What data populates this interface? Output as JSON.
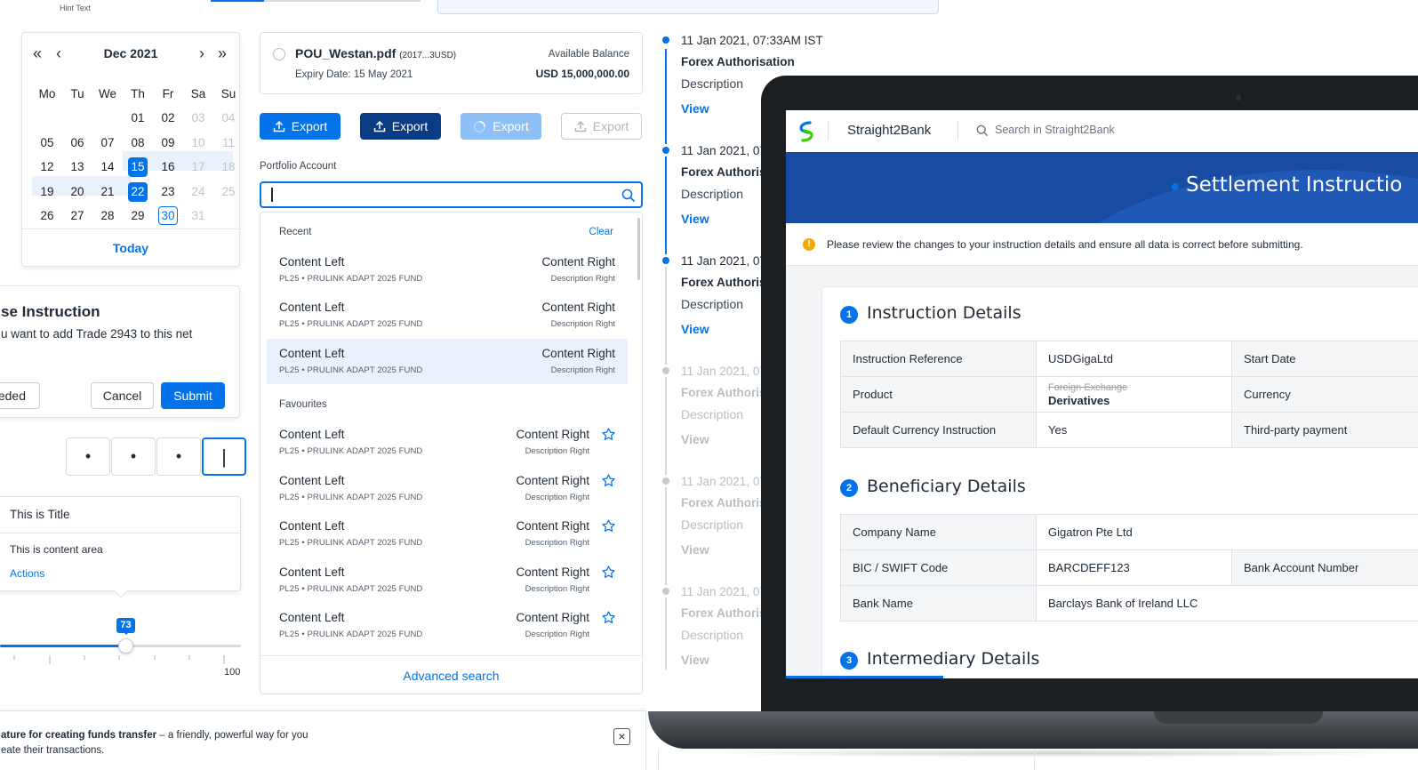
{
  "top": {
    "hint_text": "Hint Text"
  },
  "calendar": {
    "month_label": "Dec 2021",
    "nav": {
      "first": "«",
      "prev": "‹",
      "next": "›",
      "last": "»"
    },
    "weekdays": [
      "Mo",
      "Tu",
      "We",
      "Th",
      "Fr",
      "Sa",
      "Su"
    ],
    "rows": [
      [
        "",
        "",
        "",
        "01",
        "02",
        "03",
        "04"
      ],
      [
        "05",
        "06",
        "07",
        "08",
        "09",
        "10",
        "11"
      ],
      [
        "12",
        "13",
        "14",
        "15",
        "16",
        "17",
        "18"
      ],
      [
        "19",
        "20",
        "21",
        "22",
        "23",
        "24",
        "25"
      ],
      [
        "26",
        "27",
        "28",
        "29",
        "30",
        "31",
        ""
      ]
    ],
    "today_label": "Today"
  },
  "dialog": {
    "title": "se Instruction",
    "body": "u want to add Trade 2943 to this net",
    "left_button": "eded",
    "cancel": "Cancel",
    "submit": "Submit"
  },
  "pin": {
    "digits": [
      "•",
      "•",
      "•",
      "|"
    ]
  },
  "popover": {
    "title": "This is Title",
    "content": "This is content area",
    "actions": "Actions"
  },
  "slider": {
    "value": "73",
    "max_label": "100",
    "value_fraction": 0.73
  },
  "banner": {
    "bold": "ature for creating funds transfer",
    "rest": " – a friendly, powerful way for you",
    "line2": "eate their transactions.",
    "close": "×"
  },
  "file_card": {
    "name": "POU_Westan.pdf",
    "meta": "(2017...3USD)",
    "expiry": "Expiry Date: 15 May 2021",
    "balance_label": "Available Balance",
    "balance_value": "USD 15,000,000.00"
  },
  "buttons": {
    "export": "Export"
  },
  "portfolio": {
    "label": "Portfolio Account",
    "input_value": "",
    "recent_header": "Recent",
    "clear": "Clear",
    "favourites_header": "Favourites",
    "advanced": "Advanced search",
    "item": {
      "left": "Content Left",
      "sub": "PL25 • PRULINK ADAPT 2025 FUND",
      "right": "Content Right",
      "right_sub": "Description Right"
    }
  },
  "timeline": {
    "date": "11 Jan 2021, 07:33AM IST",
    "date_short": "11 Jan 2021, 07",
    "title": "Forex Authorisation",
    "title_short": "Forex Authoris",
    "desc": "Description",
    "link": "View"
  },
  "laptop": {
    "brand": "Straight2Bank",
    "search_placeholder": "Search in Straight2Bank",
    "hero_title": "Settlement Instructio",
    "notice": "Please review the changes to your instruction details and ensure all data is correct before submitting.",
    "sections": [
      {
        "num": "1",
        "title": "Instruction Details"
      },
      {
        "num": "2",
        "title": "Beneficiary Details"
      },
      {
        "num": "3",
        "title": "Intermediary Details"
      }
    ],
    "instruction_rows": [
      {
        "label": "Instruction Reference",
        "value": "USDGigaLtd",
        "label2": "Start Date"
      },
      {
        "label": "Product",
        "old_value": "Foreign Exchange",
        "value": "Derivatives",
        "label2": "Currency"
      },
      {
        "label": "Default Currency Instruction",
        "value": "Yes",
        "label2": "Third-party payment"
      }
    ],
    "beneficiary_rows": [
      {
        "label": "Company Name",
        "value": "Gigatron Pte Ltd",
        "label2": ""
      },
      {
        "label": "BIC / SWIFT Code",
        "value": "BARCDEFF123",
        "label2": "Bank Account Number"
      },
      {
        "label": "Bank Name",
        "value": "Barclays Bank of Ireland LLC",
        "label2": ""
      }
    ]
  },
  "colors": {
    "primary": "#0473ea",
    "dark_blue": "#0a3c85",
    "light_blue": "#8ec0f7",
    "hero": "#1a4ba3",
    "warning": "#f2a900"
  }
}
